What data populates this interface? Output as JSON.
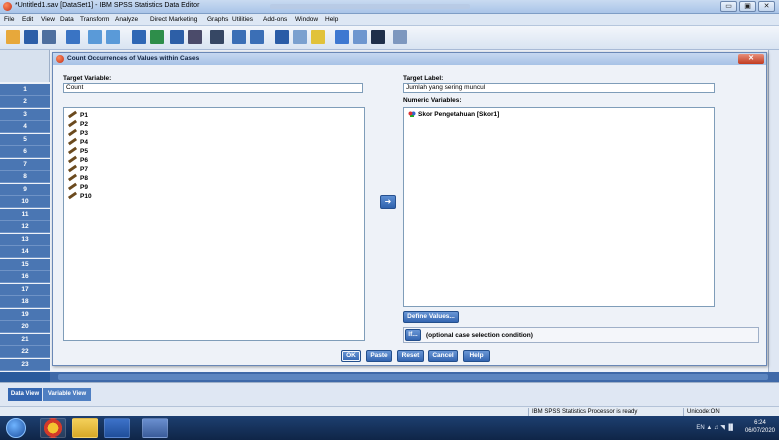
{
  "window": {
    "title": "*Untitled1.sav [DataSet1] - IBM SPSS Statistics Data Editor",
    "buttons": {
      "minimize": "▭",
      "maximize": "▣",
      "close": "✕"
    }
  },
  "menu": [
    "File",
    "Edit",
    "View",
    "Data",
    "Transform",
    "Analyze",
    "Direct Marketing",
    "Graphs",
    "Utilities",
    "Add-ons",
    "Window",
    "Help"
  ],
  "toolbar_icons": [
    "open-icon",
    "save-icon",
    "print-icon",
    "dialog-recall-icon",
    "undo-icon",
    "redo-icon",
    "goto-case-icon",
    "goto-variable-icon",
    "variables-icon",
    "run-icon",
    "find-icon",
    "insert-cases-icon",
    "insert-variable-icon",
    "split-file-icon",
    "weight-cases-icon",
    "select-cases-icon",
    "value-labels-icon",
    "use-sets-icon",
    "show-all-icon",
    "spelling-icon"
  ],
  "row_numbers": [
    "1",
    "2",
    "3",
    "4",
    "5",
    "6",
    "7",
    "8",
    "9",
    "10",
    "11",
    "12",
    "13",
    "14",
    "15",
    "16",
    "17",
    "18",
    "19",
    "20",
    "21",
    "22",
    "23"
  ],
  "dialog": {
    "title": "Count Occurrences of Values within Cases",
    "close": "✕",
    "target_variable_label": "Target Variable:",
    "target_variable_value": "Count",
    "target_label_label": "Target Label:",
    "target_label_value": "Jumlah yang sering muncul",
    "numeric_variables_label": "Numeric Variables:",
    "source_variables": [
      "P1",
      "P2",
      "P3",
      "P4",
      "P5",
      "P6",
      "P7",
      "P8",
      "P9",
      "P10"
    ],
    "numeric_variables": [
      "Skor Pengetahuan [Skor1]"
    ],
    "move_arrow": "➜",
    "define_values_button": "Define Values...",
    "if_button": "If...",
    "if_condition_text": "(optional case selection condition)",
    "buttons": {
      "ok": "OK",
      "paste": "Paste",
      "reset": "Reset",
      "cancel": "Cancel",
      "help": "Help"
    }
  },
  "tabs": {
    "data_view": "Data View",
    "variable_view": "Variable View"
  },
  "status": {
    "processor": "IBM SPSS Statistics Processor is ready",
    "encoding": "Unicode:ON"
  },
  "taskbar": {
    "language": "EN",
    "time": "6:24",
    "date": "06/07/2020"
  },
  "colors": {
    "accent": "#3466b1",
    "row_header": "#4a76b3",
    "taskbar": "#0f2547"
  }
}
